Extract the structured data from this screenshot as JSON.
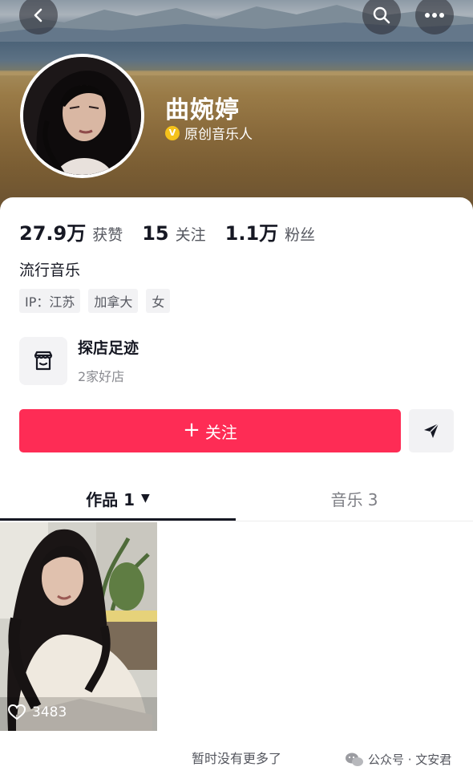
{
  "header": {
    "back_icon": "chevron-left-icon",
    "search_icon": "search-icon",
    "more_icon": "more-dots-icon"
  },
  "profile": {
    "nickname": "曲婉婷",
    "verify_badge": "V",
    "verify_text": "原创音乐人",
    "verify_color": "#f5c21b"
  },
  "stats": [
    {
      "value": "27.9万",
      "label": "获赞"
    },
    {
      "value": "15",
      "label": "关注"
    },
    {
      "value": "1.1万",
      "label": "粉丝"
    }
  ],
  "bio": "流行音乐",
  "tags": [
    "IP：江苏",
    "加拿大",
    "女"
  ],
  "shop": {
    "icon": "storefront-icon",
    "title": "探店足迹",
    "subtitle": "2家好店"
  },
  "actions": {
    "follow_plus": "+",
    "follow_label": "关注",
    "follow_color": "#fe2c55",
    "send_icon": "send-arrow-icon"
  },
  "tabs": [
    {
      "label": "作品 1",
      "caret": "▼",
      "active": true
    },
    {
      "label": "音乐 3",
      "active": false
    }
  ],
  "video": {
    "like_icon": "heart-icon",
    "likes": "3483"
  },
  "footer": {
    "no_more": "暂时没有更多了",
    "watermark_icon": "wechat-icon",
    "watermark": "公众号 · 文安君"
  }
}
